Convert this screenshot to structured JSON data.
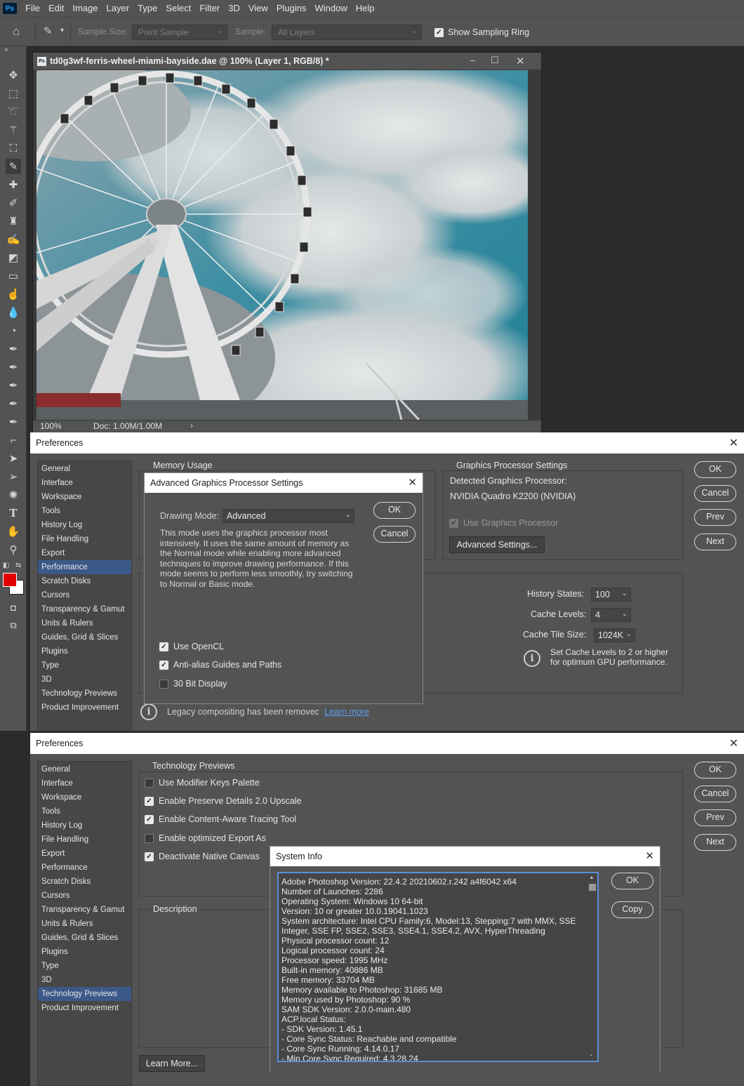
{
  "menubar": {
    "logo": "Ps",
    "items": [
      "File",
      "Edit",
      "Image",
      "Layer",
      "Type",
      "Select",
      "Filter",
      "3D",
      "View",
      "Plugins",
      "Window",
      "Help"
    ]
  },
  "options_bar": {
    "sample_size_label": "Sample Size:",
    "sample_size_value": "Point Sample",
    "sample_label": "Sample:",
    "sample_value": "All Layers",
    "show_sampling_ring_label": "Show Sampling Ring",
    "show_sampling_ring_checked": true
  },
  "document": {
    "title": "td0g3wf-ferris-wheel-miami-bayside.dae @ 100% (Layer 1, RGB/8) *",
    "zoom": "100%",
    "doc_size": "Doc: 1.00M/1.00M"
  },
  "pref1": {
    "title": "Preferences",
    "sidebar": [
      "General",
      "Interface",
      "Workspace",
      "Tools",
      "History Log",
      "File Handling",
      "Export",
      "Performance",
      "Scratch Disks",
      "Cursors",
      "Transparency & Gamut",
      "Units & Rulers",
      "Guides, Grid & Slices",
      "Plugins",
      "Type",
      "3D",
      "Technology Previews",
      "Product Improvement"
    ],
    "selected": "Performance",
    "memory_group": "Memory Usage",
    "gpu_group": "Graphics Processor Settings",
    "detected_label": "Detected Graphics Processor:",
    "gpu_name": "NVIDIA Quadro K2200 (NVIDIA)",
    "use_gpu_label": "Use Graphics Processor",
    "advanced_settings_btn": "Advanced Settings...",
    "history_states_label": "History States:",
    "history_states_value": "100",
    "cache_levels_label": "Cache Levels:",
    "cache_levels_value": "4",
    "cache_tile_label": "Cache Tile Size:",
    "cache_tile_value": "1024K",
    "cache_hint": "Set Cache Levels to 2 or higher for optimum GPU performance.",
    "legacy_text": "Legacy compositing has been removec",
    "learn_more": "Learn more",
    "buttons": {
      "ok": "OK",
      "cancel": "Cancel",
      "prev": "Prev",
      "next": "Next"
    }
  },
  "adv_gpu": {
    "title": "Advanced Graphics Processor Settings",
    "drawing_mode_label": "Drawing Mode:",
    "drawing_mode_value": "Advanced",
    "description": "This mode uses the graphics processor most intensively.  It uses the same amount of memory as the Normal mode while enabling more advanced techniques to improve drawing performance.  If this mode seems to perform less smoothly, try switching to Normal or Basic mode.",
    "use_opencl": "Use OpenCL",
    "anti_alias": "Anti-alias Guides and Paths",
    "bit30": "30 Bit Display",
    "ok": "OK",
    "cancel": "Cancel"
  },
  "pref2": {
    "title": "Preferences",
    "selected": "Technology Previews",
    "tech_group": "Technology Previews",
    "options": [
      {
        "label": "Use Modifier Keys Palette",
        "checked": false
      },
      {
        "label": "Enable Preserve Details 2.0 Upscale",
        "checked": true
      },
      {
        "label": "Enable Content-Aware Tracing Tool",
        "checked": true
      },
      {
        "label": "Enable optimized Export As",
        "checked": false
      },
      {
        "label": "Deactivate Native Canvas",
        "checked": true
      }
    ],
    "description_group": "Description",
    "learn_more_btn": "Learn More...",
    "buttons": {
      "ok": "OK",
      "cancel": "Cancel",
      "prev": "Prev",
      "next": "Next"
    }
  },
  "sysinfo": {
    "title": "System Info",
    "ok": "OK",
    "copy": "Copy",
    "lines": [
      "Adobe Photoshop Version: 22.4.2 20210602.r.242 a4f6042  x64",
      "Number of Launches: 2286",
      "Operating System: Windows 10 64-bit",
      "Version: 10 or greater 10.0.19041.1023",
      "System architecture: Intel CPU Family:6, Model:13, Stepping:7 with MMX, SSE",
      "Integer, SSE FP, SSE2, SSE3, SSE4.1, SSE4.2, AVX, HyperThreading",
      "Physical processor count: 12",
      "Logical processor count: 24",
      "Processor speed: 1995 MHz",
      "Built-in memory: 40886 MB",
      "Free memory: 33704 MB",
      "Memory available to Photoshop: 31685 MB",
      "Memory used by Photoshop: 90 %",
      "SAM SDK Version: 2.0.0-main.480",
      "ACP.local Status:",
      " - SDK Version: 1.45.1",
      " - Core Sync Status: Reachable and compatible",
      " - Core Sync Running: 4.14.0.17",
      " - Min Core Sync Required: 4.3.28.24"
    ]
  },
  "colors": {
    "panel": "#535353",
    "selection": "#3b5988",
    "foreground_swatch": "#e00000",
    "background_swatch": "#ffffff"
  }
}
